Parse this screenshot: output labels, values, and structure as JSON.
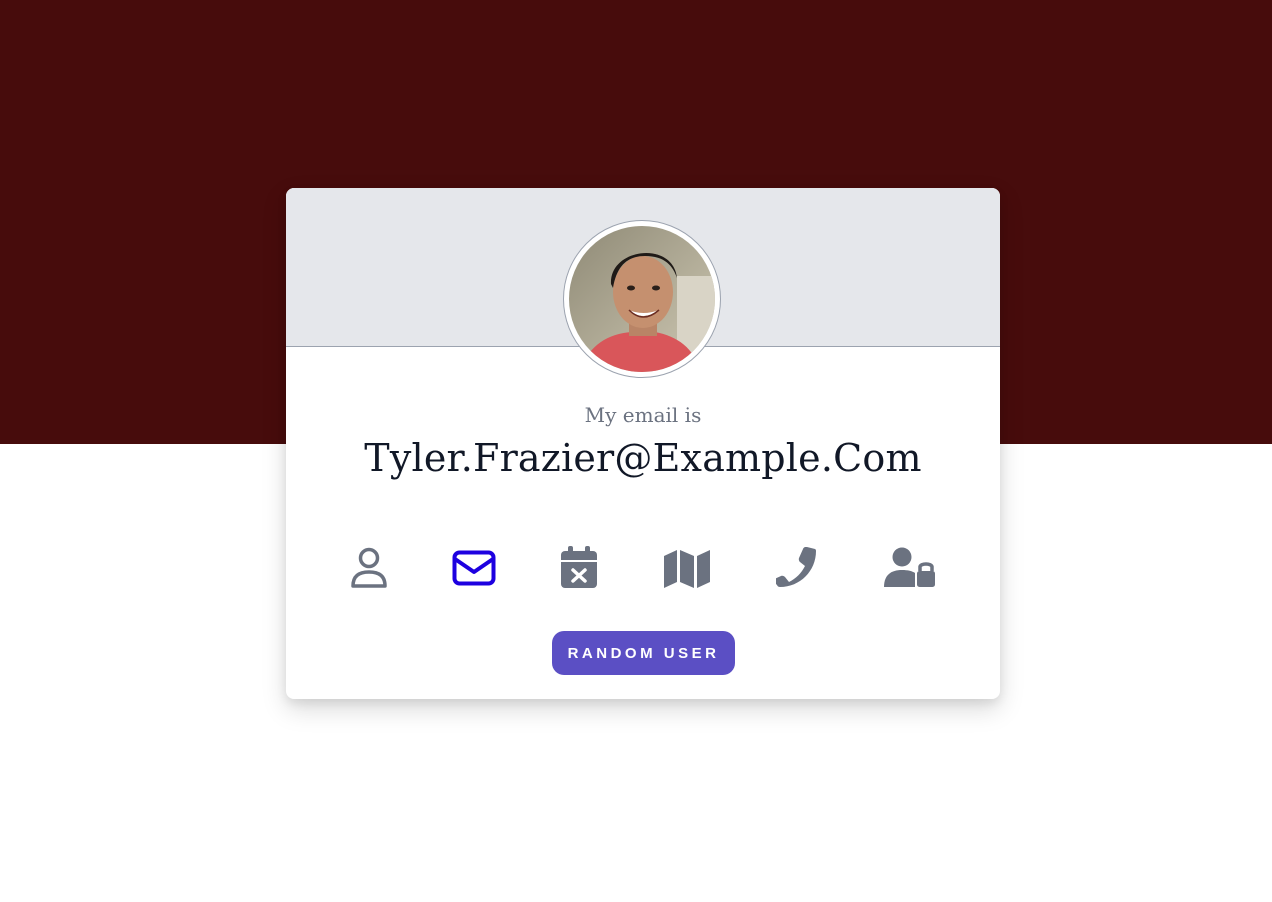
{
  "profile": {
    "label": "My email is",
    "value": "Tyler.Frazier@Example.Com"
  },
  "icons": [
    {
      "name": "user-icon",
      "active": false
    },
    {
      "name": "envelope-icon",
      "active": true
    },
    {
      "name": "calendar-icon",
      "active": false
    },
    {
      "name": "map-icon",
      "active": false
    },
    {
      "name": "phone-icon",
      "active": false
    },
    {
      "name": "user-lock-icon",
      "active": false
    }
  ],
  "actions": {
    "random_label": "RANDOM USER"
  },
  "colors": {
    "background_band": "#470c0c",
    "icon_default": "#6b7280",
    "icon_active": "#1d00e0",
    "button": "#5b4fc4"
  }
}
